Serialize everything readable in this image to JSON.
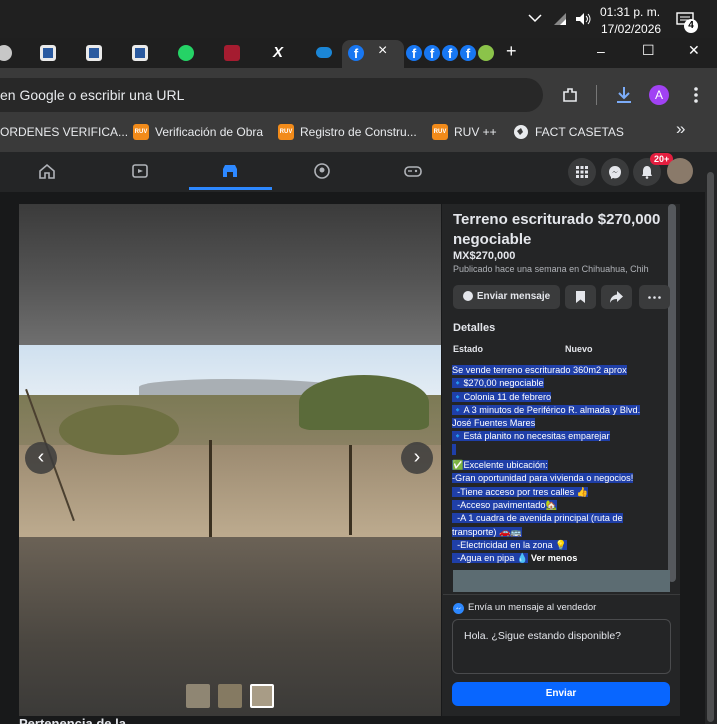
{
  "taskbar": {
    "time": "01:31 p. m.",
    "date": "17/02/2026",
    "notification_count": "4"
  },
  "browser": {
    "active_tab_close": "×",
    "new_tab": "+",
    "window_controls": [
      "–",
      "☐",
      "✕"
    ],
    "omnibox_text": "en Google o escribir una URL",
    "profile_initial": "A",
    "bookmarks": [
      "ORDENES VERIFICA...",
      "Verificación de Obra",
      "Registro de Constru...",
      "RUV ++",
      "FACT CASETAS"
    ],
    "bookmarks_more": "»"
  },
  "facebook": {
    "notification_badge": "20+",
    "listing": {
      "title": "Terreno escriturado $270,000 negociable",
      "price": "MX$270,000",
      "posted": "Publicado hace una semana en Chihuahua, Chih",
      "send_message_button": "Enviar mensaje",
      "details_heading": "Detalles",
      "condition_label": "Estado",
      "condition_value": "Nuevo",
      "description_lines": [
        "Se vende terreno escriturado 360m2 aprox",
        "🔹$270,00 negociable",
        "🔹Colonia 11 de febrero",
        "🔹A 3 minutos de Periférico R. almada y Blvd.",
        "José Fuentes Mares",
        "🔹Está planito no necesitas emparejar",
        "",
        "✅Excelente ubicación:",
        "-Gran oportunidad para vivienda o negocios!",
        "  -Tiene acceso por tres calles 👍",
        "  -Acceso pavimentado🏡",
        "  -A 1 cuadra de avenida principal (ruta de",
        "transporte) 🚗🚌",
        "  -Electricidad en la zona 💡",
        "  -Agua en pipa 💧"
      ],
      "see_less": "Ver menos",
      "message_seller_label": "Envía un mensaje al vendedor",
      "message_text": "Hola. ¿Sigue estando disponible?",
      "send_button": "Enviar",
      "bottom_heading": "Pertenencia de la"
    }
  },
  "colors": {
    "fb_blue": "#1877f2",
    "send_blue": "#0866ff",
    "highlight": "#1f3fa8",
    "badge_red": "#e41e3f"
  }
}
